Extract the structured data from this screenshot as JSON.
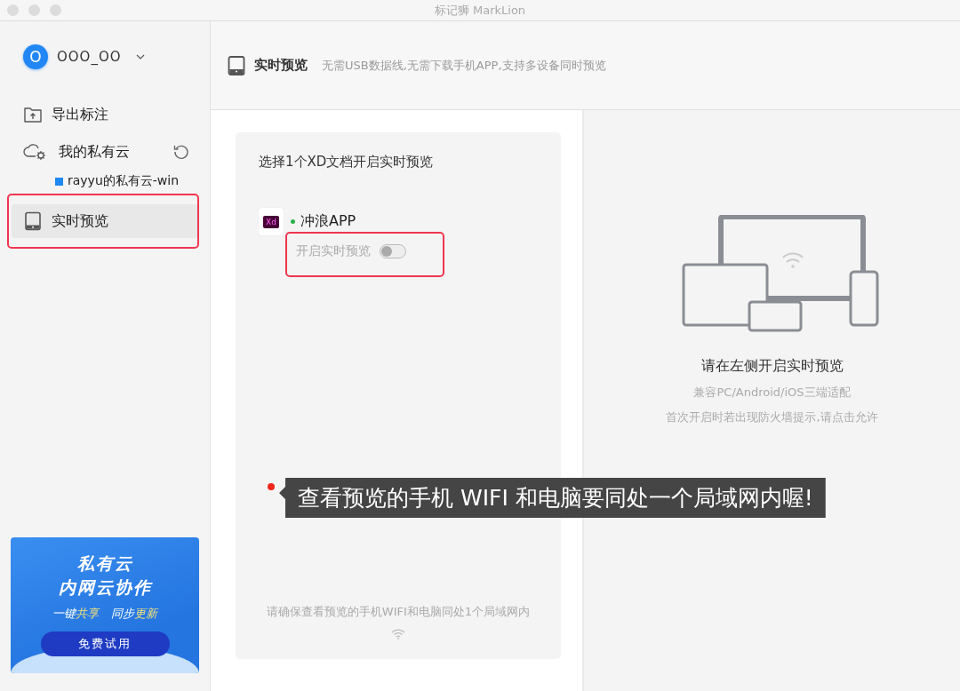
{
  "window": {
    "title": "标记狮 MarkLion"
  },
  "sidebar": {
    "user": {
      "avatar_letter": "O",
      "name": "OOO_OO"
    },
    "items": [
      {
        "kind": "export",
        "label": "导出标注",
        "selected": false
      },
      {
        "kind": "cloud",
        "label": "我的私有云",
        "selected": false,
        "children": [
          {
            "label": "rayyu的私有云-win",
            "color": "#1e88f5"
          }
        ]
      },
      {
        "kind": "preview",
        "label": "实时预览",
        "selected": true
      }
    ],
    "promo": {
      "title_lines": [
        "私有云",
        "内网云协作"
      ],
      "tagline": [
        {
          "text": "一键",
          "highlight": false
        },
        {
          "text": "共享",
          "highlight": true
        },
        {
          "text": "同步",
          "highlight": false
        },
        {
          "text": "更新",
          "highlight": true
        }
      ],
      "button": "免费试用"
    }
  },
  "header": {
    "title": "实时预览",
    "subtitle": "无需USB数据线,无需下载手机APP,支持多设备同时预览"
  },
  "panel": {
    "heading": "选择1个XD文档开启实时预览",
    "files": [
      {
        "icon_label": "Xd",
        "name": "冲浪APP",
        "online": true,
        "toggle_label": "开启实时预览",
        "on": false
      }
    ],
    "footer_note": "请确保查看预览的手机WIFI和电脑同处1个局域网内"
  },
  "preview": {
    "message": "请在左侧开启实时预览",
    "notes": [
      "兼容PC/Android/iOS三端适配",
      "首次开启时若出现防火墙提示,请点击允许"
    ]
  },
  "callout": {
    "text": "查看预览的手机 WIFI 和电脑要同处一个局域网内喔!"
  }
}
